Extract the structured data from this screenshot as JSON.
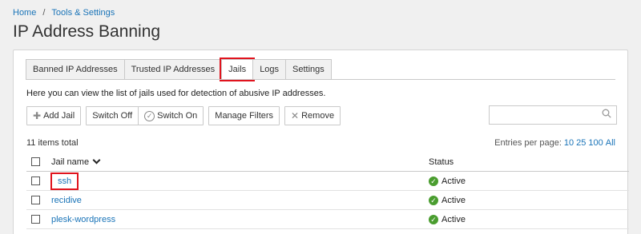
{
  "breadcrumb": {
    "home": "Home",
    "separator": "/",
    "current": "Tools & Settings"
  },
  "page_title": "IP Address Banning",
  "tabs": [
    {
      "label": "Banned IP Addresses",
      "active": false
    },
    {
      "label": "Trusted IP Addresses",
      "active": false
    },
    {
      "label": "Jails",
      "active": true
    },
    {
      "label": "Logs",
      "active": false
    },
    {
      "label": "Settings",
      "active": false
    }
  ],
  "description": "Here you can view the list of jails used for detection of abusive IP addresses.",
  "toolbar": {
    "add_jail": "Add Jail",
    "switch_off": "Switch Off",
    "switch_on": "Switch On",
    "manage_filters": "Manage Filters",
    "remove": "Remove"
  },
  "search": {
    "value": "",
    "placeholder": ""
  },
  "items_total": "11 items total",
  "pager": {
    "label": "Entries per page:",
    "options": [
      "10",
      "25",
      "100",
      "All"
    ]
  },
  "table": {
    "columns": {
      "name": "Jail name",
      "status": "Status"
    },
    "rows": [
      {
        "name": "ssh",
        "status": "Active",
        "highlighted": true
      },
      {
        "name": "recidive",
        "status": "Active"
      },
      {
        "name": "plesk-wordpress",
        "status": "Active"
      }
    ]
  },
  "colors": {
    "link": "#1a74b8",
    "highlight": "#e0141e",
    "active_status": "#4a9d2f"
  }
}
